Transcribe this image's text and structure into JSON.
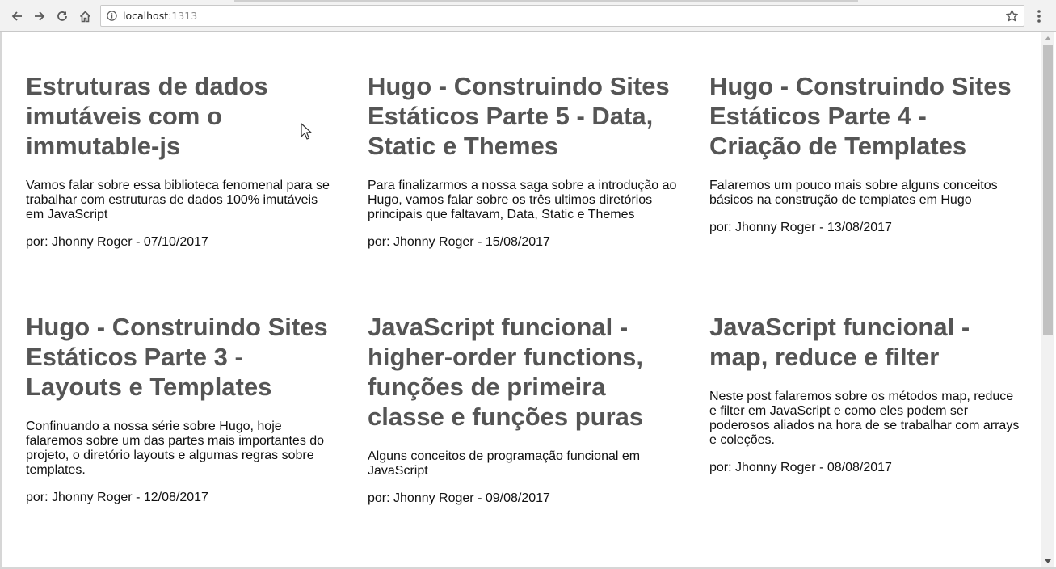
{
  "browser": {
    "url_host": "localhost",
    "url_port": ":1313",
    "icons": {
      "back": "arrow-left-icon",
      "forward": "arrow-right-icon",
      "reload": "reload-icon",
      "home": "home-icon",
      "info": "info-icon",
      "bookmark": "star-icon",
      "menu": "kebab-menu-icon"
    }
  },
  "colors": {
    "title": "#555555",
    "text": "#111111",
    "toolbar_bg": "#f2f2f2"
  },
  "posts": [
    {
      "title": "Estruturas de dados imutáveis com o immutable-js",
      "summary": "Vamos falar sobre essa biblioteca fenomenal para se trabalhar com estruturas de dados 100% imutáveis em JavaScript",
      "meta": "por: Jhonny Roger - 07/10/2017"
    },
    {
      "title": "Hugo - Construindo Sites Estáticos Parte 5 - Data, Static e Themes",
      "summary": "Para finalizarmos a nossa saga sobre a introdução ao Hugo, vamos falar sobre os três ultimos diretórios principais que faltavam, Data, Static e Themes",
      "meta": "por: Jhonny Roger - 15/08/2017"
    },
    {
      "title": "Hugo - Construindo Sites Estáticos Parte 4 - Criação de Templates",
      "summary": "Falaremos um pouco mais sobre alguns conceitos básicos na construção de templates em Hugo",
      "meta": "por: Jhonny Roger - 13/08/2017"
    },
    {
      "title": "Hugo - Construindo Sites Estáticos Parte 3 - Layouts e Templates",
      "summary": "Confinuando a nossa série sobre Hugo, hoje falaremos sobre um das partes mais importantes do projeto, o diretório layouts e algumas regras sobre templates.",
      "meta": "por: Jhonny Roger - 12/08/2017"
    },
    {
      "title": "JavaScript funcional - higher-order functions, funções de primeira classe e funções puras",
      "summary": "Alguns conceitos de programação funcional em JavaScript",
      "meta": "por: Jhonny Roger - 09/08/2017"
    },
    {
      "title": "JavaScript funcional - map, reduce e filter",
      "summary": "Neste post falaremos sobre os métodos map, reduce e filter em JavaScript e como eles podem ser poderosos aliados na hora de se trabalhar com arrays e coleções.",
      "meta": "por: Jhonny Roger - 08/08/2017"
    }
  ]
}
